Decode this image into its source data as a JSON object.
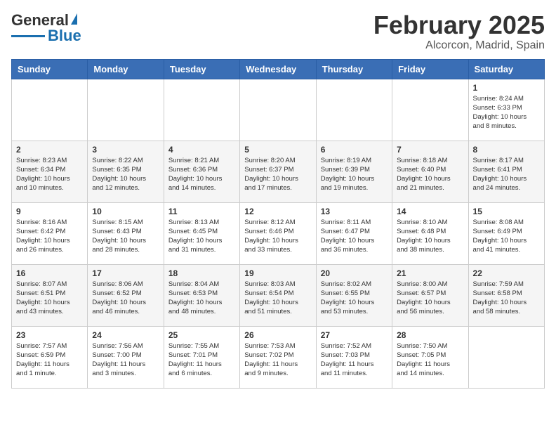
{
  "header": {
    "logo_general": "General",
    "logo_blue": "Blue",
    "month": "February 2025",
    "location": "Alcorcon, Madrid, Spain"
  },
  "weekdays": [
    "Sunday",
    "Monday",
    "Tuesday",
    "Wednesday",
    "Thursday",
    "Friday",
    "Saturday"
  ],
  "weeks": [
    [
      {
        "day": "",
        "info": ""
      },
      {
        "day": "",
        "info": ""
      },
      {
        "day": "",
        "info": ""
      },
      {
        "day": "",
        "info": ""
      },
      {
        "day": "",
        "info": ""
      },
      {
        "day": "",
        "info": ""
      },
      {
        "day": "1",
        "info": "Sunrise: 8:24 AM\nSunset: 6:33 PM\nDaylight: 10 hours\nand 8 minutes."
      }
    ],
    [
      {
        "day": "2",
        "info": "Sunrise: 8:23 AM\nSunset: 6:34 PM\nDaylight: 10 hours\nand 10 minutes."
      },
      {
        "day": "3",
        "info": "Sunrise: 8:22 AM\nSunset: 6:35 PM\nDaylight: 10 hours\nand 12 minutes."
      },
      {
        "day": "4",
        "info": "Sunrise: 8:21 AM\nSunset: 6:36 PM\nDaylight: 10 hours\nand 14 minutes."
      },
      {
        "day": "5",
        "info": "Sunrise: 8:20 AM\nSunset: 6:37 PM\nDaylight: 10 hours\nand 17 minutes."
      },
      {
        "day": "6",
        "info": "Sunrise: 8:19 AM\nSunset: 6:39 PM\nDaylight: 10 hours\nand 19 minutes."
      },
      {
        "day": "7",
        "info": "Sunrise: 8:18 AM\nSunset: 6:40 PM\nDaylight: 10 hours\nand 21 minutes."
      },
      {
        "day": "8",
        "info": "Sunrise: 8:17 AM\nSunset: 6:41 PM\nDaylight: 10 hours\nand 24 minutes."
      }
    ],
    [
      {
        "day": "9",
        "info": "Sunrise: 8:16 AM\nSunset: 6:42 PM\nDaylight: 10 hours\nand 26 minutes."
      },
      {
        "day": "10",
        "info": "Sunrise: 8:15 AM\nSunset: 6:43 PM\nDaylight: 10 hours\nand 28 minutes."
      },
      {
        "day": "11",
        "info": "Sunrise: 8:13 AM\nSunset: 6:45 PM\nDaylight: 10 hours\nand 31 minutes."
      },
      {
        "day": "12",
        "info": "Sunrise: 8:12 AM\nSunset: 6:46 PM\nDaylight: 10 hours\nand 33 minutes."
      },
      {
        "day": "13",
        "info": "Sunrise: 8:11 AM\nSunset: 6:47 PM\nDaylight: 10 hours\nand 36 minutes."
      },
      {
        "day": "14",
        "info": "Sunrise: 8:10 AM\nSunset: 6:48 PM\nDaylight: 10 hours\nand 38 minutes."
      },
      {
        "day": "15",
        "info": "Sunrise: 8:08 AM\nSunset: 6:49 PM\nDaylight: 10 hours\nand 41 minutes."
      }
    ],
    [
      {
        "day": "16",
        "info": "Sunrise: 8:07 AM\nSunset: 6:51 PM\nDaylight: 10 hours\nand 43 minutes."
      },
      {
        "day": "17",
        "info": "Sunrise: 8:06 AM\nSunset: 6:52 PM\nDaylight: 10 hours\nand 46 minutes."
      },
      {
        "day": "18",
        "info": "Sunrise: 8:04 AM\nSunset: 6:53 PM\nDaylight: 10 hours\nand 48 minutes."
      },
      {
        "day": "19",
        "info": "Sunrise: 8:03 AM\nSunset: 6:54 PM\nDaylight: 10 hours\nand 51 minutes."
      },
      {
        "day": "20",
        "info": "Sunrise: 8:02 AM\nSunset: 6:55 PM\nDaylight: 10 hours\nand 53 minutes."
      },
      {
        "day": "21",
        "info": "Sunrise: 8:00 AM\nSunset: 6:57 PM\nDaylight: 10 hours\nand 56 minutes."
      },
      {
        "day": "22",
        "info": "Sunrise: 7:59 AM\nSunset: 6:58 PM\nDaylight: 10 hours\nand 58 minutes."
      }
    ],
    [
      {
        "day": "23",
        "info": "Sunrise: 7:57 AM\nSunset: 6:59 PM\nDaylight: 11 hours\nand 1 minute."
      },
      {
        "day": "24",
        "info": "Sunrise: 7:56 AM\nSunset: 7:00 PM\nDaylight: 11 hours\nand 3 minutes."
      },
      {
        "day": "25",
        "info": "Sunrise: 7:55 AM\nSunset: 7:01 PM\nDaylight: 11 hours\nand 6 minutes."
      },
      {
        "day": "26",
        "info": "Sunrise: 7:53 AM\nSunset: 7:02 PM\nDaylight: 11 hours\nand 9 minutes."
      },
      {
        "day": "27",
        "info": "Sunrise: 7:52 AM\nSunset: 7:03 PM\nDaylight: 11 hours\nand 11 minutes."
      },
      {
        "day": "28",
        "info": "Sunrise: 7:50 AM\nSunset: 7:05 PM\nDaylight: 11 hours\nand 14 minutes."
      },
      {
        "day": "",
        "info": ""
      }
    ]
  ]
}
